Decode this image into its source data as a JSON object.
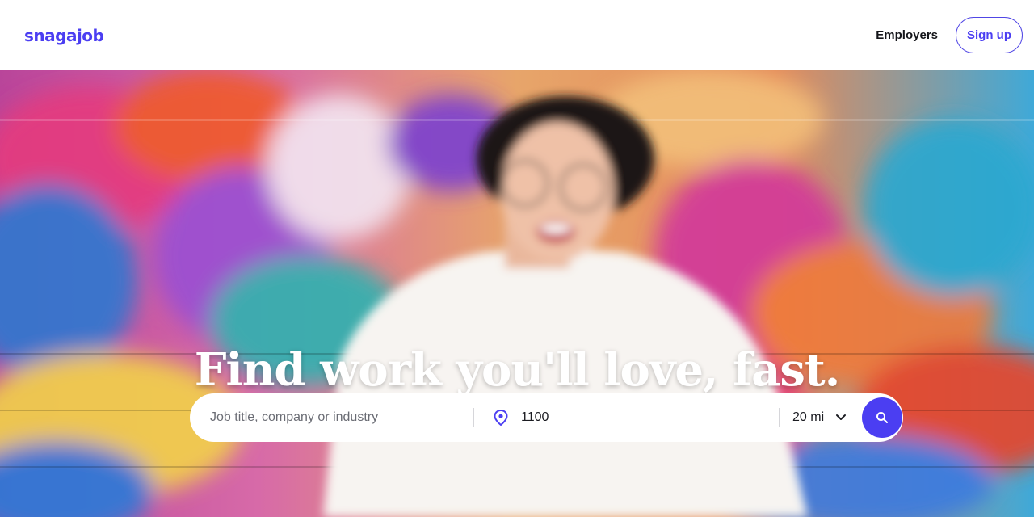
{
  "header": {
    "logo": "snagajob",
    "nav_employers": "Employers",
    "nav_signup": "Sign up"
  },
  "hero": {
    "title": "Find work you'll love, fast."
  },
  "search": {
    "job_placeholder": "Job title, company or industry",
    "job_value": "",
    "location_value": "1100",
    "radius_value": "20 mi",
    "location_icon": "map-pin-icon",
    "radius_icon": "chevron-down-icon",
    "submit_icon": "search-icon"
  },
  "colors": {
    "brand": "#4b3ef2",
    "text": "#14151a",
    "white": "#ffffff"
  }
}
